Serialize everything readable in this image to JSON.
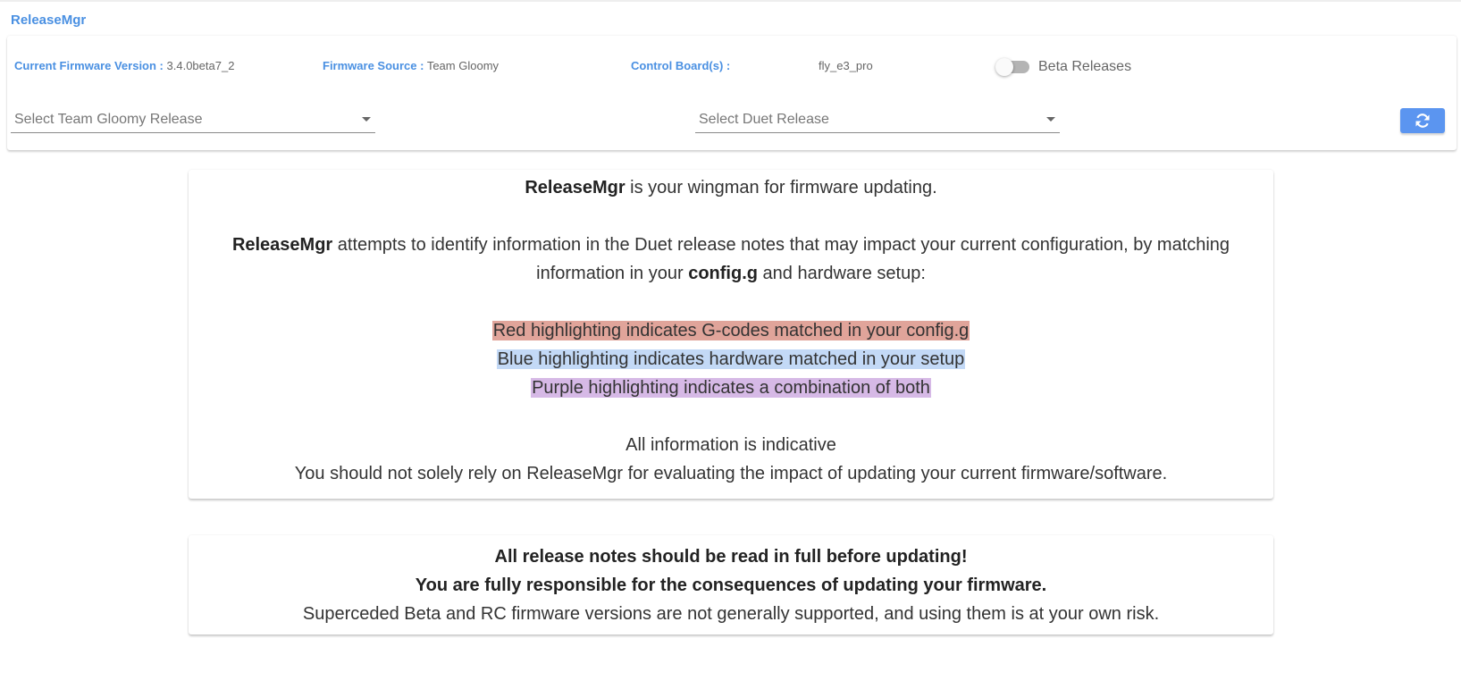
{
  "app": {
    "title": "ReleaseMgr"
  },
  "header": {
    "firmware_version_label": "Current Firmware Version :",
    "firmware_version_value": "3.4.0beta7_2",
    "firmware_source_label": "Firmware Source :",
    "firmware_source_value": "Team Gloomy",
    "control_board_label": "Control Board(s) :",
    "control_board_value": "fly_e3_pro",
    "beta_toggle_label": "Beta Releases",
    "beta_toggle_on": false
  },
  "selects": {
    "team_gloomy_placeholder": "Select Team Gloomy Release",
    "duet_placeholder": "Select Duet Release"
  },
  "icons": {
    "refresh": "refresh-icon",
    "dropdown": "chevron-down-icon"
  },
  "intro": {
    "brand": "ReleaseMgr",
    "line1_rest": " is your wingman for firmware updating.",
    "line2_rest_a": " attempts to identify information in the Duet release notes that may impact your current configuration, by matching information in your ",
    "config_file": "config.g",
    "line2_rest_b": " and hardware setup:",
    "legend_red": "Red highlighting indicates G-codes matched in your config.g",
    "legend_blue": "Blue highlighting indicates hardware matched in your setup",
    "legend_purple": "Purple highlighting indicates a combination of both",
    "indicative": "All information is indicative",
    "disclaimer": "You should not solely rely on ReleaseMgr for evaluating the impact of updating your current firmware/software."
  },
  "warning": {
    "line1": "All release notes should be read in full before updating!",
    "line2": "You are fully responsible for the consequences of updating your firmware.",
    "line3": "Superceded Beta and RC firmware versions are not generally supported, and using them is at your own risk."
  },
  "colors": {
    "accent": "#4a90e2",
    "button": "#5b95f0",
    "highlight_red": "#e0a49a",
    "highlight_blue": "#c3d9f6",
    "highlight_purple": "#d6b9e6"
  }
}
